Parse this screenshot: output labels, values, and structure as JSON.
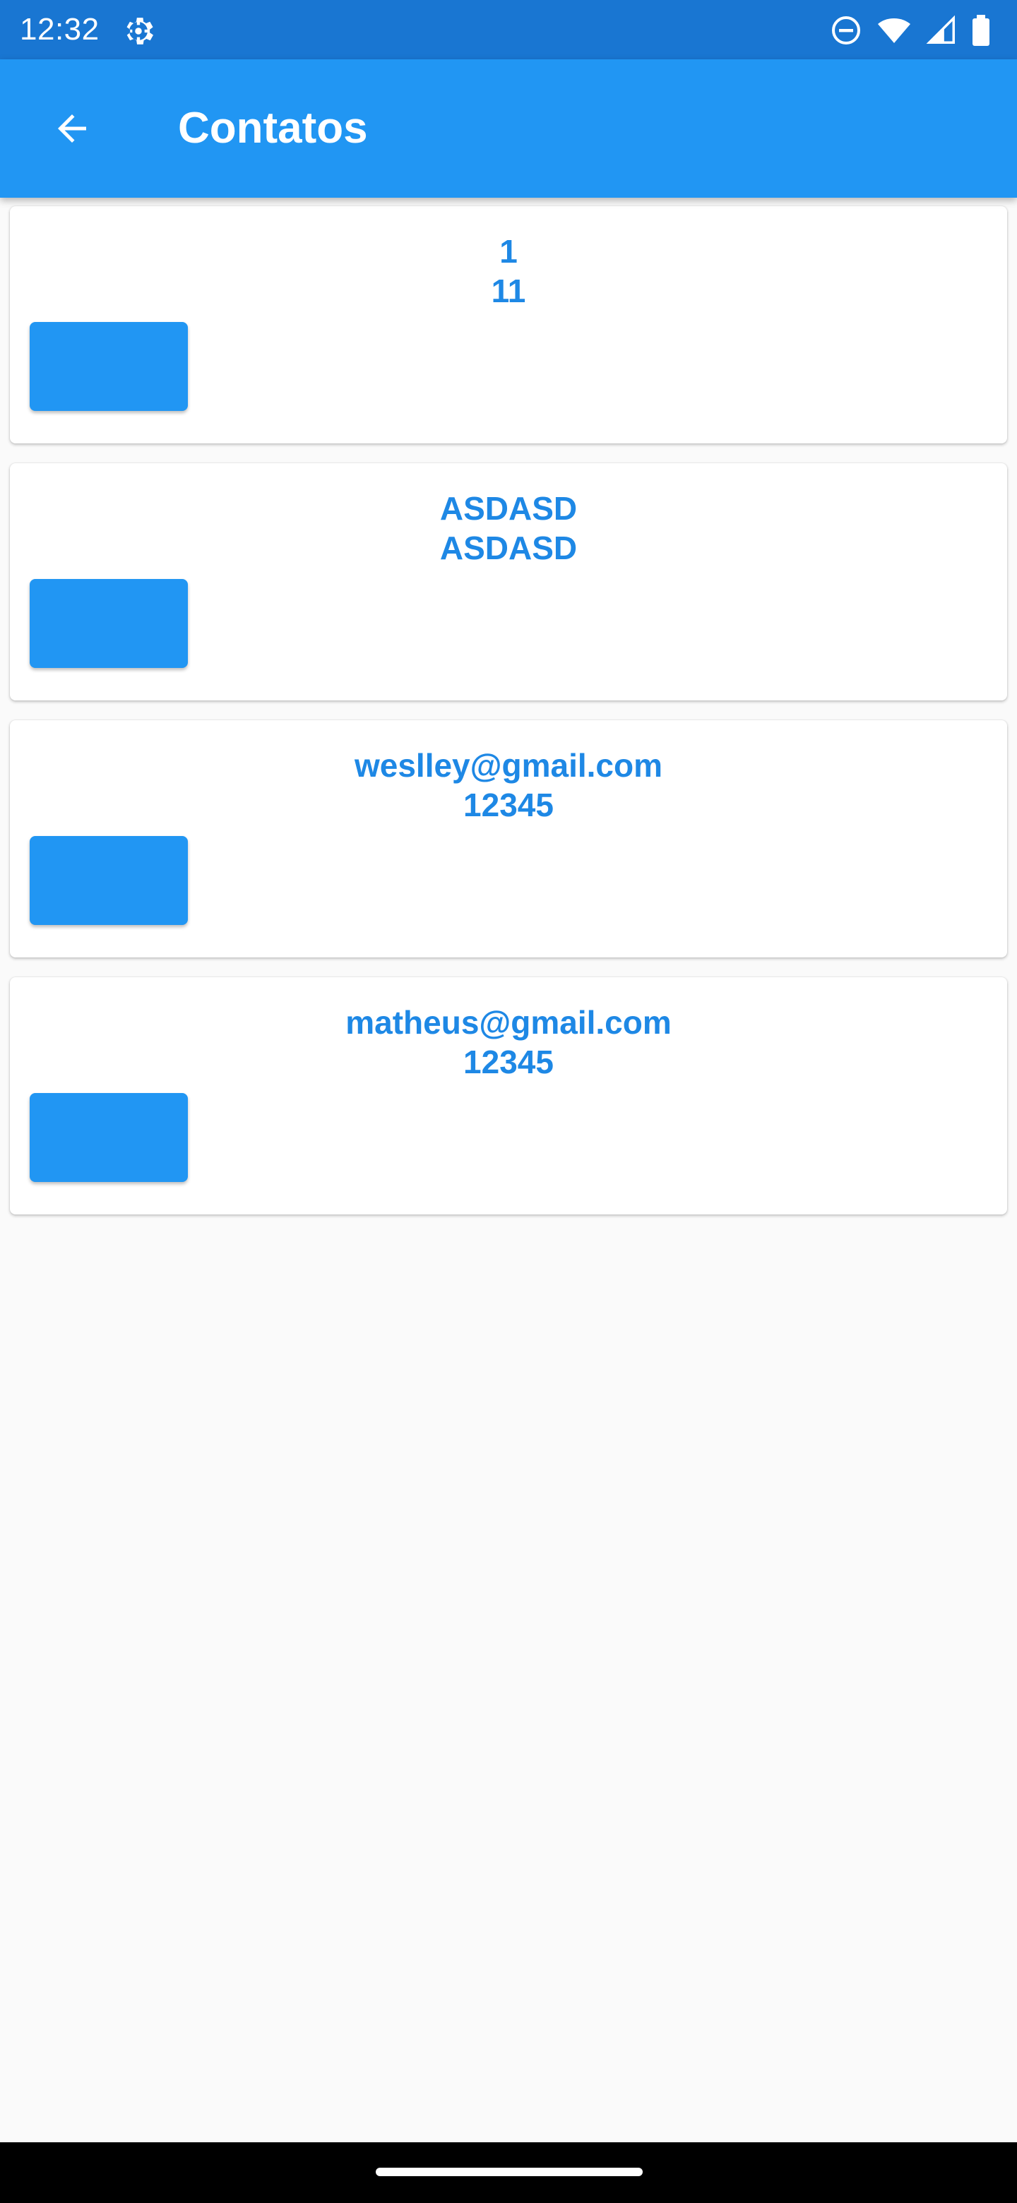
{
  "status_bar": {
    "time": "12:32",
    "left_icons": [
      "settings-gear-icon"
    ],
    "right_icons": [
      "do-not-disturb-icon",
      "wifi-icon",
      "cell-signal-icon",
      "battery-icon"
    ]
  },
  "app_bar": {
    "back_icon": "arrow-back-icon",
    "title": "Contatos"
  },
  "contacts": [
    {
      "line1": "1",
      "line2": "11"
    },
    {
      "line1": "ASDASD",
      "line2": "ASDASD"
    },
    {
      "line1": "weslley@gmail.com",
      "line2": "12345"
    },
    {
      "line1": "matheus@gmail.com",
      "line2": "12345"
    }
  ],
  "colors": {
    "status_bar": "#1976d2",
    "app_bar": "#2196f3",
    "accent_text": "#1e88e5",
    "background": "#fafafa"
  }
}
